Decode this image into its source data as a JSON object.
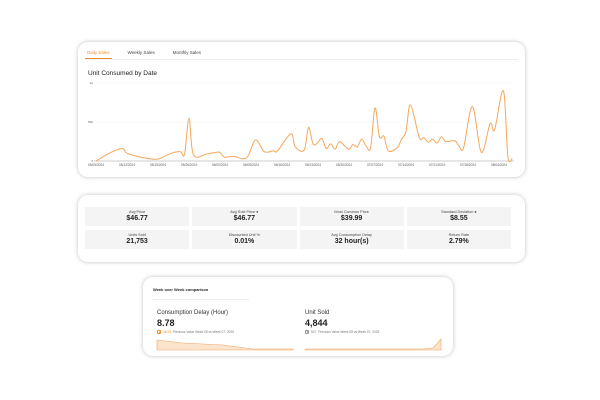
{
  "tabs": [
    {
      "label": "Daily Sales",
      "active": true
    },
    {
      "label": "Weekly Sales",
      "active": false
    },
    {
      "label": "Monthly Sales",
      "active": false
    }
  ],
  "chart_data": {
    "type": "line",
    "title": "Unit Consumed by Date",
    "xlabel": "",
    "ylabel": "",
    "ylim": [
      0,
      1000
    ],
    "yticks": [
      "0",
      "500",
      "1k"
    ],
    "ytick_values": [
      0,
      500,
      1000
    ],
    "xticks": [
      "05/05/2024",
      "05/12/2024",
      "05/19/2024",
      "05/26/2024",
      "06/02/2024",
      "06/09/2024",
      "06/16/2024",
      "06/23/2024",
      "06/30/2024",
      "07/07/2024",
      "07/14/2024",
      "07/21/2024",
      "07/28/2024",
      "08/04/2024"
    ],
    "color": "#f5a65b",
    "grid": true,
    "points": [
      [
        "05/05/2024",
        0
      ],
      [
        "05/08/2024",
        100
      ],
      [
        "05/11/2024",
        160
      ],
      [
        "05/12/2024",
        100
      ],
      [
        "05/16/2024",
        40
      ],
      [
        "05/19/2024",
        25
      ],
      [
        "05/22/2024",
        100
      ],
      [
        "05/24/2024",
        120
      ],
      [
        "05/25/2024",
        90
      ],
      [
        "05/26/2024",
        550
      ],
      [
        "05/27/2024",
        80
      ],
      [
        "05/30/2024",
        90
      ],
      [
        "06/01/2024",
        110
      ],
      [
        "06/02/2024",
        110
      ],
      [
        "06/03/2024",
        50
      ],
      [
        "06/05/2024",
        60
      ],
      [
        "06/08/2024",
        40
      ],
      [
        "06/10/2024",
        270
      ],
      [
        "06/12/2024",
        120
      ],
      [
        "06/14/2024",
        130
      ],
      [
        "06/15/2024",
        130
      ],
      [
        "06/18/2024",
        350
      ],
      [
        "06/19/2024",
        180
      ],
      [
        "06/21/2024",
        140
      ],
      [
        "06/22/2024",
        430
      ],
      [
        "06/23/2024",
        220
      ],
      [
        "06/24/2024",
        230
      ],
      [
        "06/25/2024",
        290
      ],
      [
        "06/26/2024",
        160
      ],
      [
        "06/27/2024",
        220
      ],
      [
        "06/28/2024",
        150
      ],
      [
        "06/29/2024",
        250
      ],
      [
        "07/01/2024",
        150
      ],
      [
        "07/02/2024",
        210
      ],
      [
        "07/03/2024",
        180
      ],
      [
        "07/04/2024",
        280
      ],
      [
        "07/05/2024",
        190
      ],
      [
        "07/06/2024",
        170
      ],
      [
        "07/07/2024",
        680
      ],
      [
        "07/08/2024",
        310
      ],
      [
        "07/09/2024",
        320
      ],
      [
        "07/10/2024",
        130
      ],
      [
        "07/12/2024",
        170
      ],
      [
        "07/13/2024",
        280
      ],
      [
        "07/14/2024",
        380
      ],
      [
        "07/15/2024",
        720
      ],
      [
        "07/17/2024",
        300
      ],
      [
        "07/18/2024",
        300
      ],
      [
        "07/19/2024",
        240
      ],
      [
        "07/20/2024",
        280
      ],
      [
        "07/21/2024",
        230
      ],
      [
        "07/22/2024",
        310
      ],
      [
        "07/23/2024",
        250
      ],
      [
        "07/25/2024",
        260
      ],
      [
        "07/26/2024",
        190
      ],
      [
        "07/27/2024",
        170
      ],
      [
        "07/29/2024",
        700
      ],
      [
        "07/31/2024",
        110
      ],
      [
        "08/02/2024",
        480
      ],
      [
        "08/03/2024",
        400
      ],
      [
        "08/05/2024",
        900
      ],
      [
        "08/06/2024",
        60
      ],
      [
        "08/07/2024",
        30
      ]
    ]
  },
  "metrics": [
    {
      "label": "Avg Price",
      "value": "$46.77"
    },
    {
      "label": "Avg Sold Price ●",
      "value": "$46.77"
    },
    {
      "label": "Most Common Price",
      "value": "$39.99"
    },
    {
      "label": "Standard Deviation ●",
      "value": "$8.55"
    },
    {
      "label": "Units Sold",
      "value": "21,753"
    },
    {
      "label": "Discounted Unit %",
      "value": "0.01%"
    },
    {
      "label": "Avg Consumption Delay",
      "value": "32 hour(s)"
    },
    {
      "label": "Return Rate",
      "value": "2.79%"
    }
  ],
  "wow": {
    "title": "Week over Week comparison",
    "panels": [
      {
        "label": "Consumption Delay (Hour)",
        "value": "8.78",
        "delta": "48.25",
        "sub": "Previous Value Week 08 vs Week 07, 2025",
        "color": "#f0912f"
      },
      {
        "label": "Unit Sold",
        "value": "4,844",
        "delta": "547",
        "sub": "Previous Value Week 08 vs Week 07, 2025",
        "color": "#888888"
      }
    ]
  }
}
